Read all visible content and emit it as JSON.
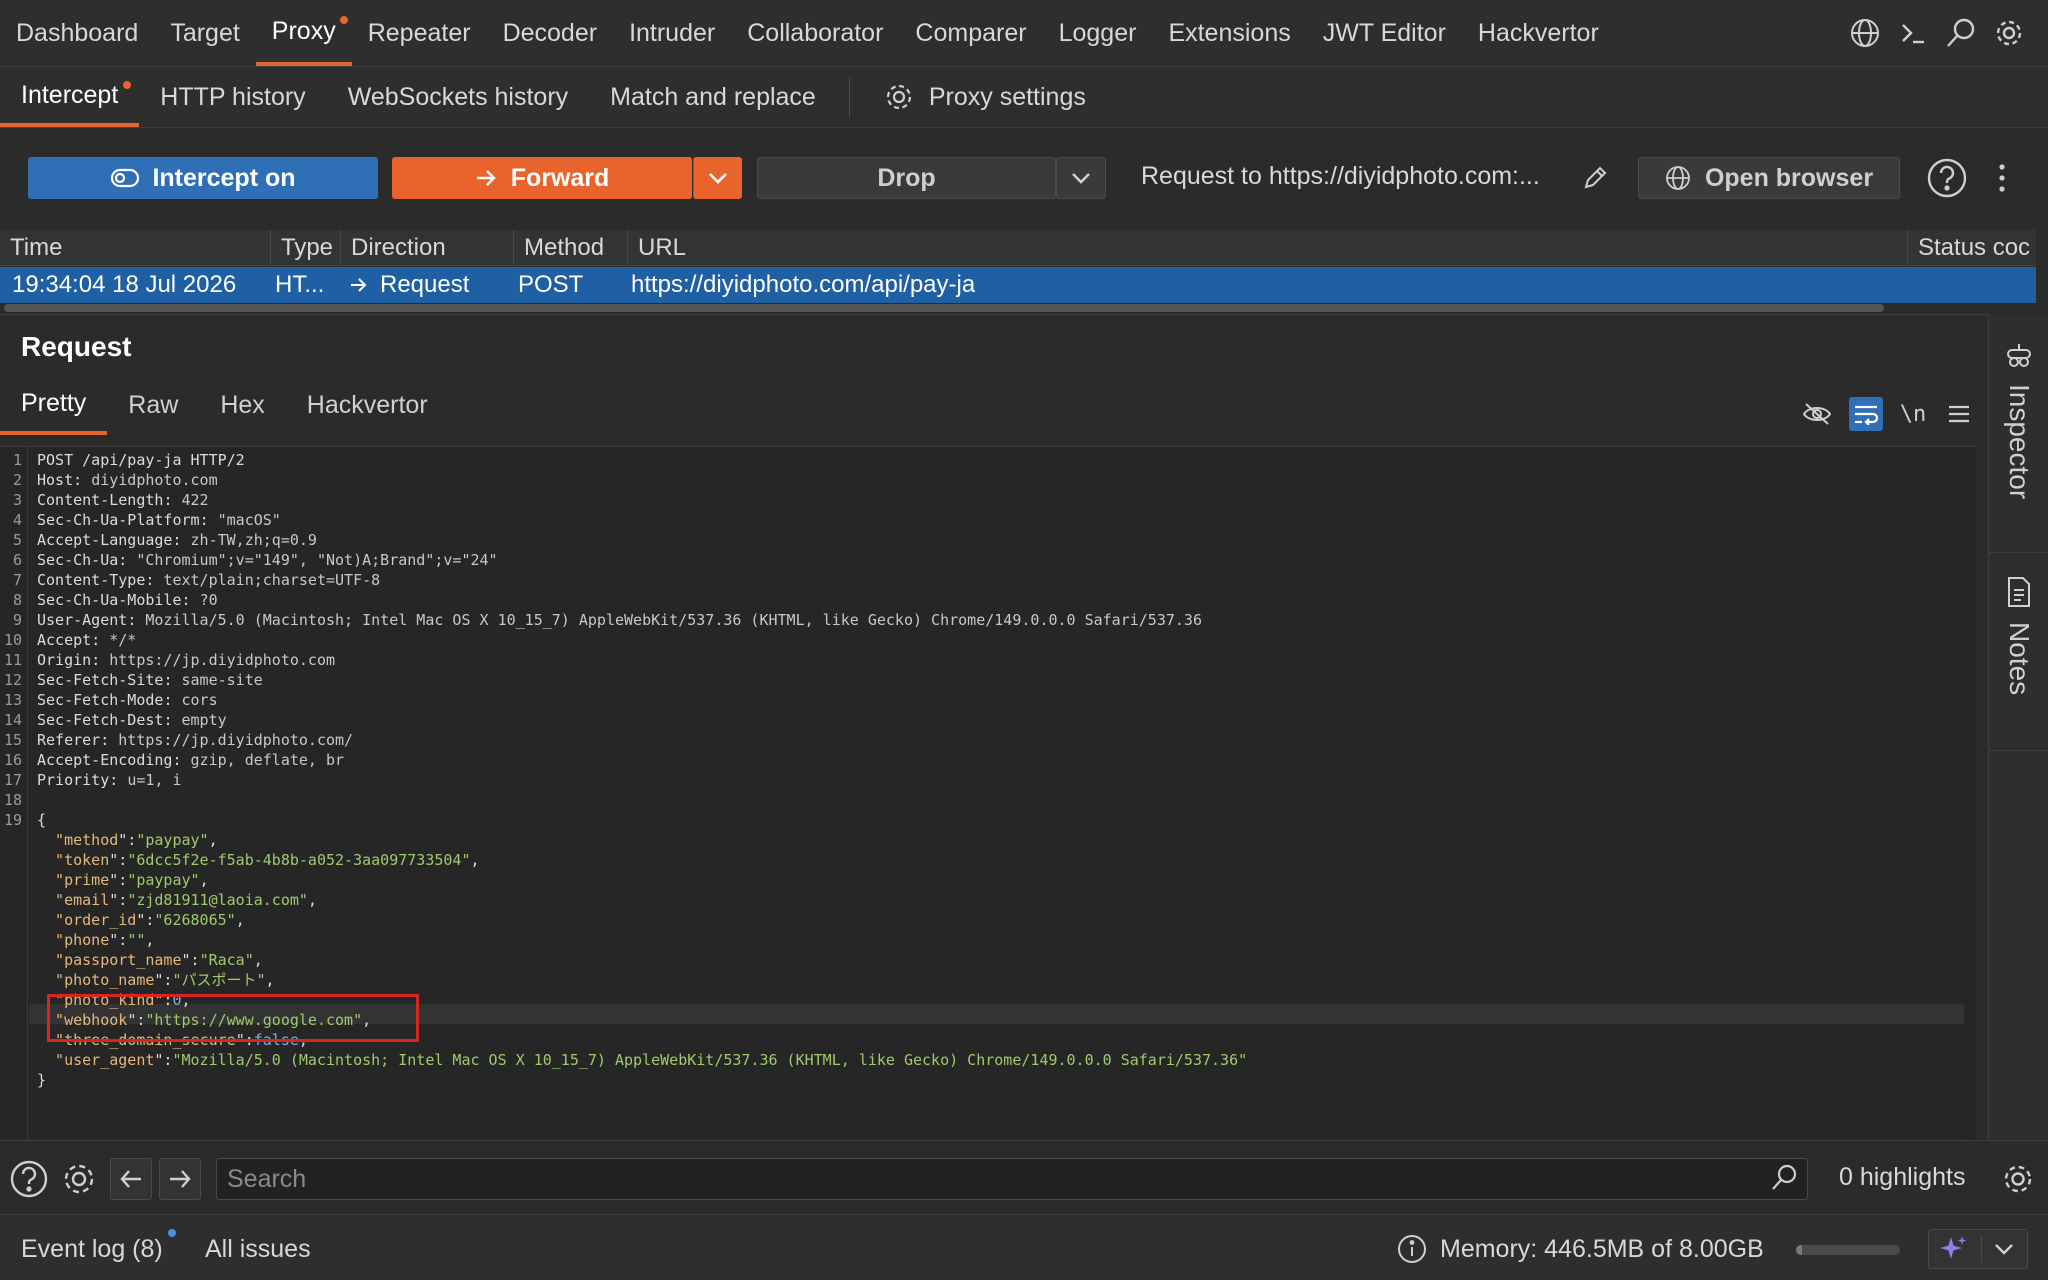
{
  "nav": {
    "tabs": [
      "Dashboard",
      "Target",
      "Proxy",
      "Repeater",
      "Decoder",
      "Intruder",
      "Collaborator",
      "Comparer",
      "Logger",
      "Extensions",
      "JWT Editor",
      "Hackvertor"
    ],
    "active": "Proxy"
  },
  "subnav": {
    "tabs": [
      "Intercept",
      "HTTP history",
      "WebSockets history",
      "Match and replace"
    ],
    "settings": "Proxy settings"
  },
  "toolbar": {
    "intercept": "Intercept on",
    "forward": "Forward",
    "drop": "Drop",
    "request_to": "Request to https://diyidphoto.com:...",
    "open_browser": "Open browser"
  },
  "table": {
    "headers": [
      "Time",
      "Type",
      "Direction",
      "Method",
      "URL",
      "Status coc"
    ],
    "row": {
      "time": "19:34:04 18 Jul 2026",
      "type": "HT...",
      "direction": "Request",
      "method": "POST",
      "url": "https://diyidphoto.com/api/pay-ja"
    }
  },
  "request": {
    "title": "Request",
    "tabs": [
      "Pretty",
      "Raw",
      "Hex",
      "Hackvertor"
    ],
    "newline_toggle": "\\n",
    "request_line": "POST /api/pay-ja HTTP/2",
    "headers": [
      {
        "name": "Host",
        "value": "diyidphoto.com"
      },
      {
        "name": "Content-Length",
        "value": "422"
      },
      {
        "name": "Sec-Ch-Ua-Platform",
        "value": "\"macOS\""
      },
      {
        "name": "Accept-Language",
        "value": "zh-TW,zh;q=0.9"
      },
      {
        "name": "Sec-Ch-Ua",
        "value": "\"Chromium\";v=\"149\", \"Not)A;Brand\";v=\"24\""
      },
      {
        "name": "Content-Type",
        "value": "text/plain;charset=UTF-8"
      },
      {
        "name": "Sec-Ch-Ua-Mobile",
        "value": "?0"
      },
      {
        "name": "User-Agent",
        "value": "Mozilla/5.0 (Macintosh; Intel Mac OS X 10_15_7) AppleWebKit/537.36 (KHTML, like Gecko) Chrome/149.0.0.0 Safari/537.36"
      },
      {
        "name": "Accept",
        "value": "*/*"
      },
      {
        "name": "Origin",
        "value": "https://jp.diyidphoto.com"
      },
      {
        "name": "Sec-Fetch-Site",
        "value": "same-site"
      },
      {
        "name": "Sec-Fetch-Mode",
        "value": "cors"
      },
      {
        "name": "Sec-Fetch-Dest",
        "value": "empty"
      },
      {
        "name": "Referer",
        "value": "https://jp.diyidphoto.com/"
      },
      {
        "name": "Accept-Encoding",
        "value": "gzip, deflate, br"
      },
      {
        "name": "Priority",
        "value": "u=1, i"
      }
    ],
    "body_open": "{",
    "body_close": "}",
    "body": [
      {
        "key": "method",
        "value": "\"paypay\"",
        "type": "string"
      },
      {
        "key": "token",
        "value": "\"6dcc5f2e-f5ab-4b8b-a052-3aa097733504\"",
        "type": "string"
      },
      {
        "key": "prime",
        "value": "\"paypay\"",
        "type": "string"
      },
      {
        "key": "email",
        "value": "\"zjd81911@laoia.com\"",
        "type": "string"
      },
      {
        "key": "order_id",
        "value": "\"6268065\"",
        "type": "string"
      },
      {
        "key": "phone",
        "value": "\"\"",
        "type": "string"
      },
      {
        "key": "passport_name",
        "value": "\"Raca\"",
        "type": "string"
      },
      {
        "key": "photo_name",
        "value": "\"パスポート\"",
        "type": "string"
      },
      {
        "key": "photo_kind",
        "value": "0",
        "type": "number"
      },
      {
        "key": "webhook",
        "value": "\"https://www.google.com\"",
        "type": "string"
      },
      {
        "key": "three_domain_secure",
        "value": "false",
        "type": "number"
      },
      {
        "key": "user_agent",
        "value": "\"Mozilla/5.0 (Macintosh; Intel Mac OS X 10_15_7) AppleWebKit/537.36 (KHTML, like Gecko) Chrome/149.0.0.0 Safari/537.36\"",
        "type": "string",
        "last": true
      }
    ]
  },
  "sidebar": {
    "inspector": "Inspector",
    "notes": "Notes"
  },
  "search": {
    "placeholder": "Search",
    "highlights": "0 highlights"
  },
  "status": {
    "event_log": "Event log (8)",
    "all_issues": "All issues",
    "memory": "Memory: 446.5MB of 8.00GB",
    "memory_used_fraction": 0.055
  },
  "colors": {
    "accent": "#e8642c",
    "selection": "#1f5fa3",
    "primary_button": "#2f6fb5",
    "highlight_box": "#d7261e"
  }
}
